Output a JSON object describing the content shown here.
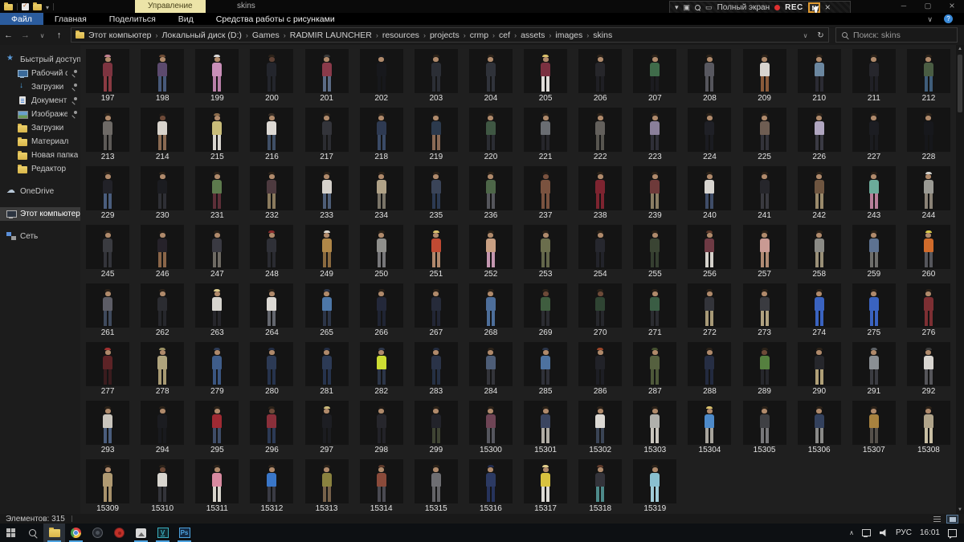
{
  "window": {
    "title": "skins",
    "contextual_header": "Управление"
  },
  "recorder": {
    "fullscreen_label": "Полный экран",
    "rec_label": "REC"
  },
  "ribbon": {
    "tabs": [
      {
        "label": "Файл",
        "accent": true
      },
      {
        "label": "Главная"
      },
      {
        "label": "Поделиться"
      },
      {
        "label": "Вид"
      }
    ],
    "contextual_tab": "Средства работы с рисунками"
  },
  "addressbar": {
    "breadcrumbs": [
      "Этот компьютер",
      "Локальный диск (D:)",
      "Games",
      "RADMIR LAUNCHER",
      "resources",
      "projects",
      "crmp",
      "cef",
      "assets",
      "images",
      "skins"
    ]
  },
  "search": {
    "placeholder": "Поиск: skins"
  },
  "sidebar": {
    "items": [
      {
        "label": "Быстрый доступ",
        "icon": "star",
        "level": 0
      },
      {
        "label": "Рабочий стол",
        "icon": "monitor",
        "level": 1,
        "pinned": true
      },
      {
        "label": "Загрузки",
        "icon": "download",
        "level": 1,
        "pinned": true
      },
      {
        "label": "Документы",
        "icon": "document",
        "level": 1,
        "pinned": true
      },
      {
        "label": "Изображения",
        "icon": "picture",
        "level": 1,
        "pinned": true
      },
      {
        "label": "Загрузки",
        "icon": "folder",
        "level": 1
      },
      {
        "label": "Материал",
        "icon": "folder",
        "level": 1
      },
      {
        "label": "Новая папка",
        "icon": "folder",
        "level": 1
      },
      {
        "label": "Редактор",
        "icon": "folder",
        "level": 1
      },
      {
        "label": "OneDrive",
        "icon": "cloud",
        "level": 0,
        "group": true
      },
      {
        "label": "Этот компьютер",
        "icon": "computer",
        "level": 0,
        "group": true,
        "selected": true
      },
      {
        "label": "Сеть",
        "icon": "network",
        "level": 0,
        "group": true
      }
    ]
  },
  "files": {
    "default_skin": "#b08a6b",
    "default_hair": "#2b2219",
    "items": [
      {
        "n": "197",
        "t": "#7d3440",
        "b": "#8a3a42",
        "h": "#c08090"
      },
      {
        "n": "198",
        "t": "#5c4a6e",
        "b": "#47597a",
        "h": "#6b4a33"
      },
      {
        "n": "199",
        "t": "#c98fb8",
        "b": "#b87fa8",
        "h": "#d8d8d8"
      },
      {
        "n": "200",
        "t": "#23252c",
        "b": "#23252c",
        "s": "#5d4033"
      },
      {
        "n": "201",
        "t": "#8a3a4a",
        "b": "#5b6b85",
        "h": "#3a3a3a"
      },
      {
        "n": "202",
        "t": "#17181c",
        "b": "#17181c",
        "h": "#17181c"
      },
      {
        "n": "203",
        "t": "#2b2e35",
        "b": "#2b2e35"
      },
      {
        "n": "204",
        "t": "#2f3239",
        "b": "#30333b"
      },
      {
        "n": "205",
        "t": "#7a3040",
        "b": "#e0dcd8",
        "h": "#d9c06b"
      },
      {
        "n": "206",
        "t": "#26262a",
        "b": "#1f1f24"
      },
      {
        "n": "207",
        "t": "#3f6b4a",
        "b": "#1c1c20"
      },
      {
        "n": "208",
        "t": "#585860",
        "b": "#55555c"
      },
      {
        "n": "209",
        "t": "#d8d4cf",
        "b": "#8a5a3a"
      },
      {
        "n": "210",
        "t": "#6b87a0",
        "b": "#2b2b33"
      },
      {
        "n": "211",
        "t": "#26262c",
        "b": "#202026"
      },
      {
        "n": "212",
        "t": "#4a5d43",
        "b": "#3f5d7a"
      },
      {
        "n": "213",
        "t": "#6e6a66",
        "b": "#5d5a57"
      },
      {
        "n": "214",
        "t": "#d8d3cc",
        "b": "#8a6a52",
        "s": "#6e4a38",
        "h": "#1f1a16"
      },
      {
        "n": "215",
        "t": "#c9bd7a",
        "b": "#d8d5cf",
        "h": "#8a6a4a"
      },
      {
        "n": "216",
        "t": "#ddd9d4",
        "b": "#3f4f66",
        "h": "#3a2f26"
      },
      {
        "n": "217",
        "t": "#33343a",
        "b": "#2b2c31"
      },
      {
        "n": "218",
        "t": "#2e3a52",
        "b": "#3a4a66"
      },
      {
        "n": "219",
        "t": "#2c3a4d",
        "b": "#8a6a55",
        "h": "#1f1a16"
      },
      {
        "n": "220",
        "t": "#3f5743",
        "b": "#2b2d33"
      },
      {
        "n": "221",
        "t": "#6a6d72",
        "b": "#26262b"
      },
      {
        "n": "222",
        "t": "#63605c",
        "b": "#57554f"
      },
      {
        "n": "223",
        "t": "#8a7f9a",
        "b": "#2f2f38"
      },
      {
        "n": "224",
        "t": "#1f2026",
        "b": "#1b1c21"
      },
      {
        "n": "225",
        "t": "#6e5d52",
        "b": "#33333a"
      },
      {
        "n": "226",
        "t": "#b0a6c0",
        "b": "#3a3a44"
      },
      {
        "n": "227",
        "t": "#1c1d22",
        "b": "#1b1c20"
      },
      {
        "n": "228",
        "t": "#17181c",
        "b": "#16171b"
      },
      {
        "n": "229",
        "t": "#222228",
        "b": "#4a5d7d"
      },
      {
        "n": "230",
        "t": "#1b1c20",
        "b": "#2e2f35"
      },
      {
        "n": "231",
        "t": "#5d7a4d",
        "b": "#5d2f38"
      },
      {
        "n": "232",
        "t": "#4d3a3f",
        "b": "#8a7a5d"
      },
      {
        "n": "233",
        "t": "#d5d1cb",
        "b": "#4d5d77"
      },
      {
        "n": "234",
        "t": "#b0a287",
        "b": "#7a7468"
      },
      {
        "n": "235",
        "t": "#3a4458",
        "b": "#2c3a52"
      },
      {
        "n": "236",
        "t": "#4d6648",
        "b": "#55565c"
      },
      {
        "n": "237",
        "t": "#7a523f",
        "b": "#7a523f",
        "s": "#7a523f",
        "h": "#1f1a16"
      },
      {
        "n": "238",
        "t": "#7d2430",
        "b": "#7d2430"
      },
      {
        "n": "239",
        "t": "#6e3a3a",
        "b": "#8a7d63"
      },
      {
        "n": "240",
        "t": "#d8d5d0",
        "b": "#3f4d68"
      },
      {
        "n": "241",
        "t": "#26262b",
        "b": "#3a3a40"
      },
      {
        "n": "242",
        "t": "#6e5540",
        "b": "#9a8a6b"
      },
      {
        "n": "243",
        "t": "#6bab9a",
        "b": "#b87f9a"
      },
      {
        "n": "244",
        "t": "#9a9a94",
        "b": "#8a8276",
        "h": "#d0d0cc"
      },
      {
        "n": "245",
        "t": "#3a3b40",
        "b": "#33343a"
      },
      {
        "n": "246",
        "t": "#26222a",
        "b": "#8a6548",
        "h": "#1f1a16"
      },
      {
        "n": "247",
        "t": "#3a3a42",
        "b": "#6e6a63"
      },
      {
        "n": "248",
        "t": "#2f3037",
        "b": "#2a2b31",
        "h": "#8a2b2b"
      },
      {
        "n": "249",
        "t": "#b08748",
        "b": "#8a6a3f",
        "h": "#d8d4cc"
      },
      {
        "n": "250",
        "t": "#8f8f8c",
        "b": "#77777a"
      },
      {
        "n": "251",
        "t": "#c04a33",
        "b": "#b0876b",
        "h": "#d9c06b"
      },
      {
        "n": "252",
        "t": "#c9a083",
        "b": "#c497b0"
      },
      {
        "n": "253",
        "t": "#6b6e4d",
        "b": "#63664a"
      },
      {
        "n": "254",
        "t": "#26272e",
        "b": "#22232a"
      },
      {
        "n": "255",
        "t": "#3a4433",
        "b": "#353f30"
      },
      {
        "n": "256",
        "t": "#6e3a44",
        "b": "#d5d2cc",
        "h": "#5d3a2b"
      },
      {
        "n": "257",
        "t": "#c99a93",
        "b": "#b08a72"
      },
      {
        "n": "258",
        "t": "#8a8a85",
        "b": "#9a9077"
      },
      {
        "n": "259",
        "t": "#5d7291",
        "b": "#6e6e6b"
      },
      {
        "n": "260",
        "t": "#d06b2b",
        "b": "#55565c",
        "h": "#d9c94a"
      },
      {
        "n": "261",
        "t": "#5d5d66",
        "b": "#3f4a5d"
      },
      {
        "n": "262",
        "t": "#2b2c31",
        "b": "#26272c"
      },
      {
        "n": "263",
        "t": "#d8d5cf",
        "b": "#26262b",
        "h": "#d9c98a"
      },
      {
        "n": "264",
        "t": "#dcd9d4",
        "b": "#63666e"
      },
      {
        "n": "265",
        "t": "#4d77a8",
        "b": "#2c3548",
        "h": "#2a3448"
      },
      {
        "n": "266",
        "t": "#23283a",
        "b": "#1f2433"
      },
      {
        "n": "267",
        "t": "#262b3a",
        "b": "#222635"
      },
      {
        "n": "268",
        "t": "#4d6e9a",
        "b": "#4d6e9a"
      },
      {
        "n": "269",
        "t": "#3f5d3f",
        "b": "#2b2c31",
        "s": "#6e4a38"
      },
      {
        "n": "270",
        "t": "#2f4433",
        "b": "#26272c",
        "s": "#6e4a38"
      },
      {
        "n": "271",
        "t": "#3a5d44",
        "b": "#2b2c31"
      },
      {
        "n": "272",
        "t": "#33343a",
        "b": "#a89a77"
      },
      {
        "n": "273",
        "t": "#3a3b40",
        "b": "#b0a280"
      },
      {
        "n": "274",
        "t": "#3a63c0",
        "b": "#3a63c0"
      },
      {
        "n": "275",
        "t": "#3a63c0",
        "b": "#3a63c0"
      },
      {
        "n": "276",
        "t": "#7d2f33",
        "b": "#7d2f33"
      },
      {
        "n": "277",
        "t": "#5d2326",
        "b": "#3a1c1e",
        "h": "#a03030"
      },
      {
        "n": "278",
        "t": "#b0a47d",
        "b": "#a89a72",
        "h": "#9a8f63"
      },
      {
        "n": "279",
        "t": "#3f5d8a",
        "b": "#3a5580",
        "h": "#2c3a55"
      },
      {
        "n": "280",
        "t": "#2c3a55",
        "b": "#26334d",
        "h": "#222c42"
      },
      {
        "n": "281",
        "t": "#2c3a55",
        "b": "#26334d",
        "h": "#222c42"
      },
      {
        "n": "282",
        "t": "#cddd33",
        "b": "#2c3548",
        "h": "#2c3548"
      },
      {
        "n": "283",
        "t": "#2a3348",
        "b": "#253044",
        "h": "#222a3d"
      },
      {
        "n": "284",
        "t": "#4d5d77",
        "b": "#33343a"
      },
      {
        "n": "285",
        "t": "#4d72a0",
        "b": "#2f3038",
        "h": "#2a3448"
      },
      {
        "n": "286",
        "t": "#212228",
        "b": "#1d1e24",
        "h": "#9a4528"
      },
      {
        "n": "287",
        "t": "#55603f",
        "b": "#4d5839",
        "h": "#44502f"
      },
      {
        "n": "288",
        "t": "#262e44",
        "b": "#222a3f"
      },
      {
        "n": "289",
        "t": "#55803f",
        "b": "#26272c",
        "s": "#6e4a38"
      },
      {
        "n": "290",
        "t": "#26272c",
        "b": "#b0a077"
      },
      {
        "n": "291",
        "t": "#8a8f94",
        "b": "#3a3b41",
        "h": "#5d6166"
      },
      {
        "n": "292",
        "t": "#d8d5d0",
        "b": "#55555a",
        "h": "#3a3a3a"
      },
      {
        "n": "293",
        "t": "#c9c5bd",
        "b": "#4a5d7d"
      },
      {
        "n": "294",
        "t": "#1b1c20",
        "b": "#191a1e"
      },
      {
        "n": "295",
        "t": "#a02a33",
        "b": "#3f4d68"
      },
      {
        "n": "296",
        "t": "#8a2f3a",
        "b": "#2c3a55",
        "s": "#6e4a38"
      },
      {
        "n": "297",
        "t": "#1d1e23",
        "b": "#1b1c20",
        "h": "#c9b87a"
      },
      {
        "n": "298",
        "t": "#26262c",
        "b": "#222228",
        "h": "#1f1a16"
      },
      {
        "n": "299",
        "t": "#22232a",
        "b": "#3f4433"
      },
      {
        "n": "15300",
        "t": "#6e4455",
        "b": "#55565e"
      },
      {
        "n": "15301",
        "t": "#3a4560",
        "b": "#b0aca4"
      },
      {
        "n": "15302",
        "t": "#dcd9d4",
        "b": "#3a4455"
      },
      {
        "n": "15303",
        "t": "#b0b0ac",
        "b": "#c9c5bd"
      },
      {
        "n": "15304",
        "t": "#4d8ac9",
        "b": "#a8a49c",
        "h": "#d9c06b"
      },
      {
        "n": "15305",
        "t": "#3f4044",
        "b": "#77777a"
      },
      {
        "n": "15306",
        "t": "#33415d",
        "b": "#8a8a88"
      },
      {
        "n": "15307",
        "t": "#a8823f",
        "b": "#55504a"
      },
      {
        "n": "15308",
        "t": "#b0a48a",
        "b": "#c9bfa4"
      },
      {
        "n": "15309",
        "t": "#b09a72",
        "b": "#a8926b"
      },
      {
        "n": "15310",
        "t": "#d8d5cf",
        "b": "#33343a",
        "s": "#6e4a38"
      },
      {
        "n": "15311",
        "t": "#d88aa0",
        "b": "#d8d4cc"
      },
      {
        "n": "15312",
        "t": "#3a77c9",
        "b": "#3a3b44"
      },
      {
        "n": "15313",
        "t": "#8a823f",
        "b": "#77624a"
      },
      {
        "n": "15314",
        "t": "#8a4a3a",
        "b": "#4a4a52",
        "h": "#5d3a2b"
      },
      {
        "n": "15315",
        "t": "#6e6e72",
        "b": "#636366"
      },
      {
        "n": "15316",
        "t": "#2c3a63",
        "b": "#26335c",
        "h": "#222c4d"
      },
      {
        "n": "15317",
        "t": "#d9c23f",
        "b": "#dcd9d4",
        "h": "#e0cd8a"
      },
      {
        "n": "15318",
        "t": "#33333a",
        "b": "#4d8a8a",
        "h": "#5d3a2b"
      },
      {
        "n": "15319",
        "t": "#8ac0d0",
        "b": "#a0ccd8"
      }
    ]
  },
  "statusbar": {
    "items_count": "Элементов: 315"
  },
  "taskbar": {
    "apps": [
      {
        "id": "start"
      },
      {
        "id": "search"
      },
      {
        "id": "explorer",
        "running": true,
        "active": true
      },
      {
        "id": "chrome",
        "running": true
      },
      {
        "id": "obs"
      },
      {
        "id": "recorder"
      },
      {
        "id": "photos",
        "running": true
      },
      {
        "id": "vegas",
        "label": "V",
        "running": true
      },
      {
        "id": "photoshop",
        "label": "Ps",
        "running": true
      }
    ],
    "tray": {
      "lang": "РУС",
      "time": "16:01"
    }
  },
  "colors": {
    "accent_blue": "#2b5c9e",
    "rec_red": "#e03030",
    "running_underline": "#4da3e0",
    "folder_yellow": "#e0bd55"
  }
}
